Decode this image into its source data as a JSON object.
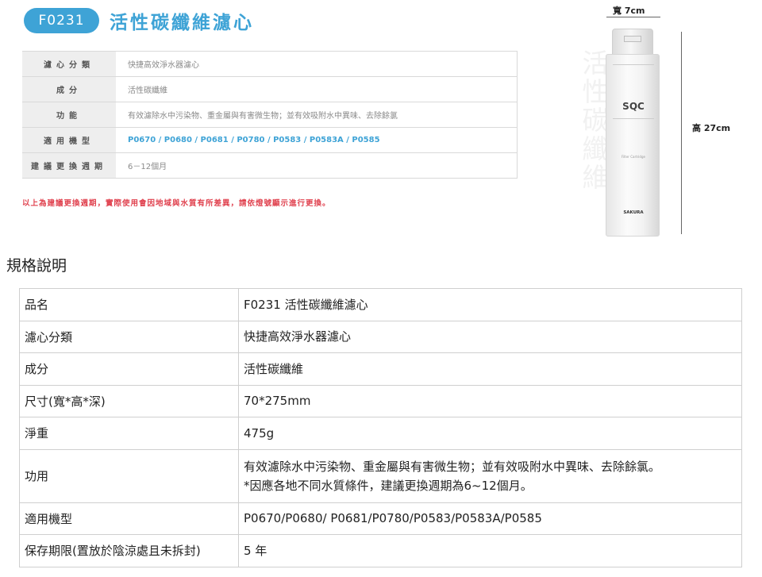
{
  "banner": {
    "code": "F0231",
    "title": "活性碳纖維濾心",
    "rows": [
      {
        "label": "濾心分類",
        "value": "快捷高效淨水器濾心",
        "style": "normal"
      },
      {
        "label": "成分",
        "value": "活性碳纖維",
        "style": "normal"
      },
      {
        "label": "功能",
        "value": "有效濾除水中污染物、重金屬與有害微生物；並有效吸附水中異味、去除餘氯",
        "style": "normal"
      },
      {
        "label": "適用機型",
        "value": "P0670 / P0680 / P0681 / P0780 / P0583 / P0583A / P0585",
        "style": "blue"
      },
      {
        "label": "建議更換週期",
        "value": "6－12個月",
        "style": "normal"
      }
    ],
    "notice": "以上為建議更換週期，實際使用會因地域與水質有所差異，請依燈號顯示進行更換。",
    "vertical_text": "活性碳纖維",
    "width_label": "寬 7cm",
    "height_label": "高 27cm",
    "cartridge": {
      "logo": "SQC",
      "brand": "SAKURA",
      "small_text": "Filter Cartridge"
    }
  },
  "spec": {
    "heading": "規格說明",
    "rows": [
      {
        "label": "品名",
        "lines": [
          "F0231 活性碳纖維濾心"
        ]
      },
      {
        "label": "濾心分類",
        "lines": [
          "快捷高效淨水器濾心"
        ]
      },
      {
        "label": "成分",
        "lines": [
          "活性碳纖維"
        ]
      },
      {
        "label": "尺寸(寬*高*深)",
        "lines": [
          "70*275mm"
        ]
      },
      {
        "label": "淨重",
        "lines": [
          "475g"
        ]
      },
      {
        "label": "功用",
        "lines": [
          "有效濾除水中污染物、重金屬與有害微生物；並有效吸附水中異味、去除餘氯。",
          "*因應各地不同水質條件，建議更換週期為6~12個月。"
        ]
      },
      {
        "label": "適用機型",
        "lines": [
          "P0670/P0680/ P0681/P0780/P0583/P0583A/P0585"
        ]
      },
      {
        "label": "保存期限(置放於陰涼處且未拆封)",
        "lines": [
          "5 年"
        ]
      }
    ]
  }
}
